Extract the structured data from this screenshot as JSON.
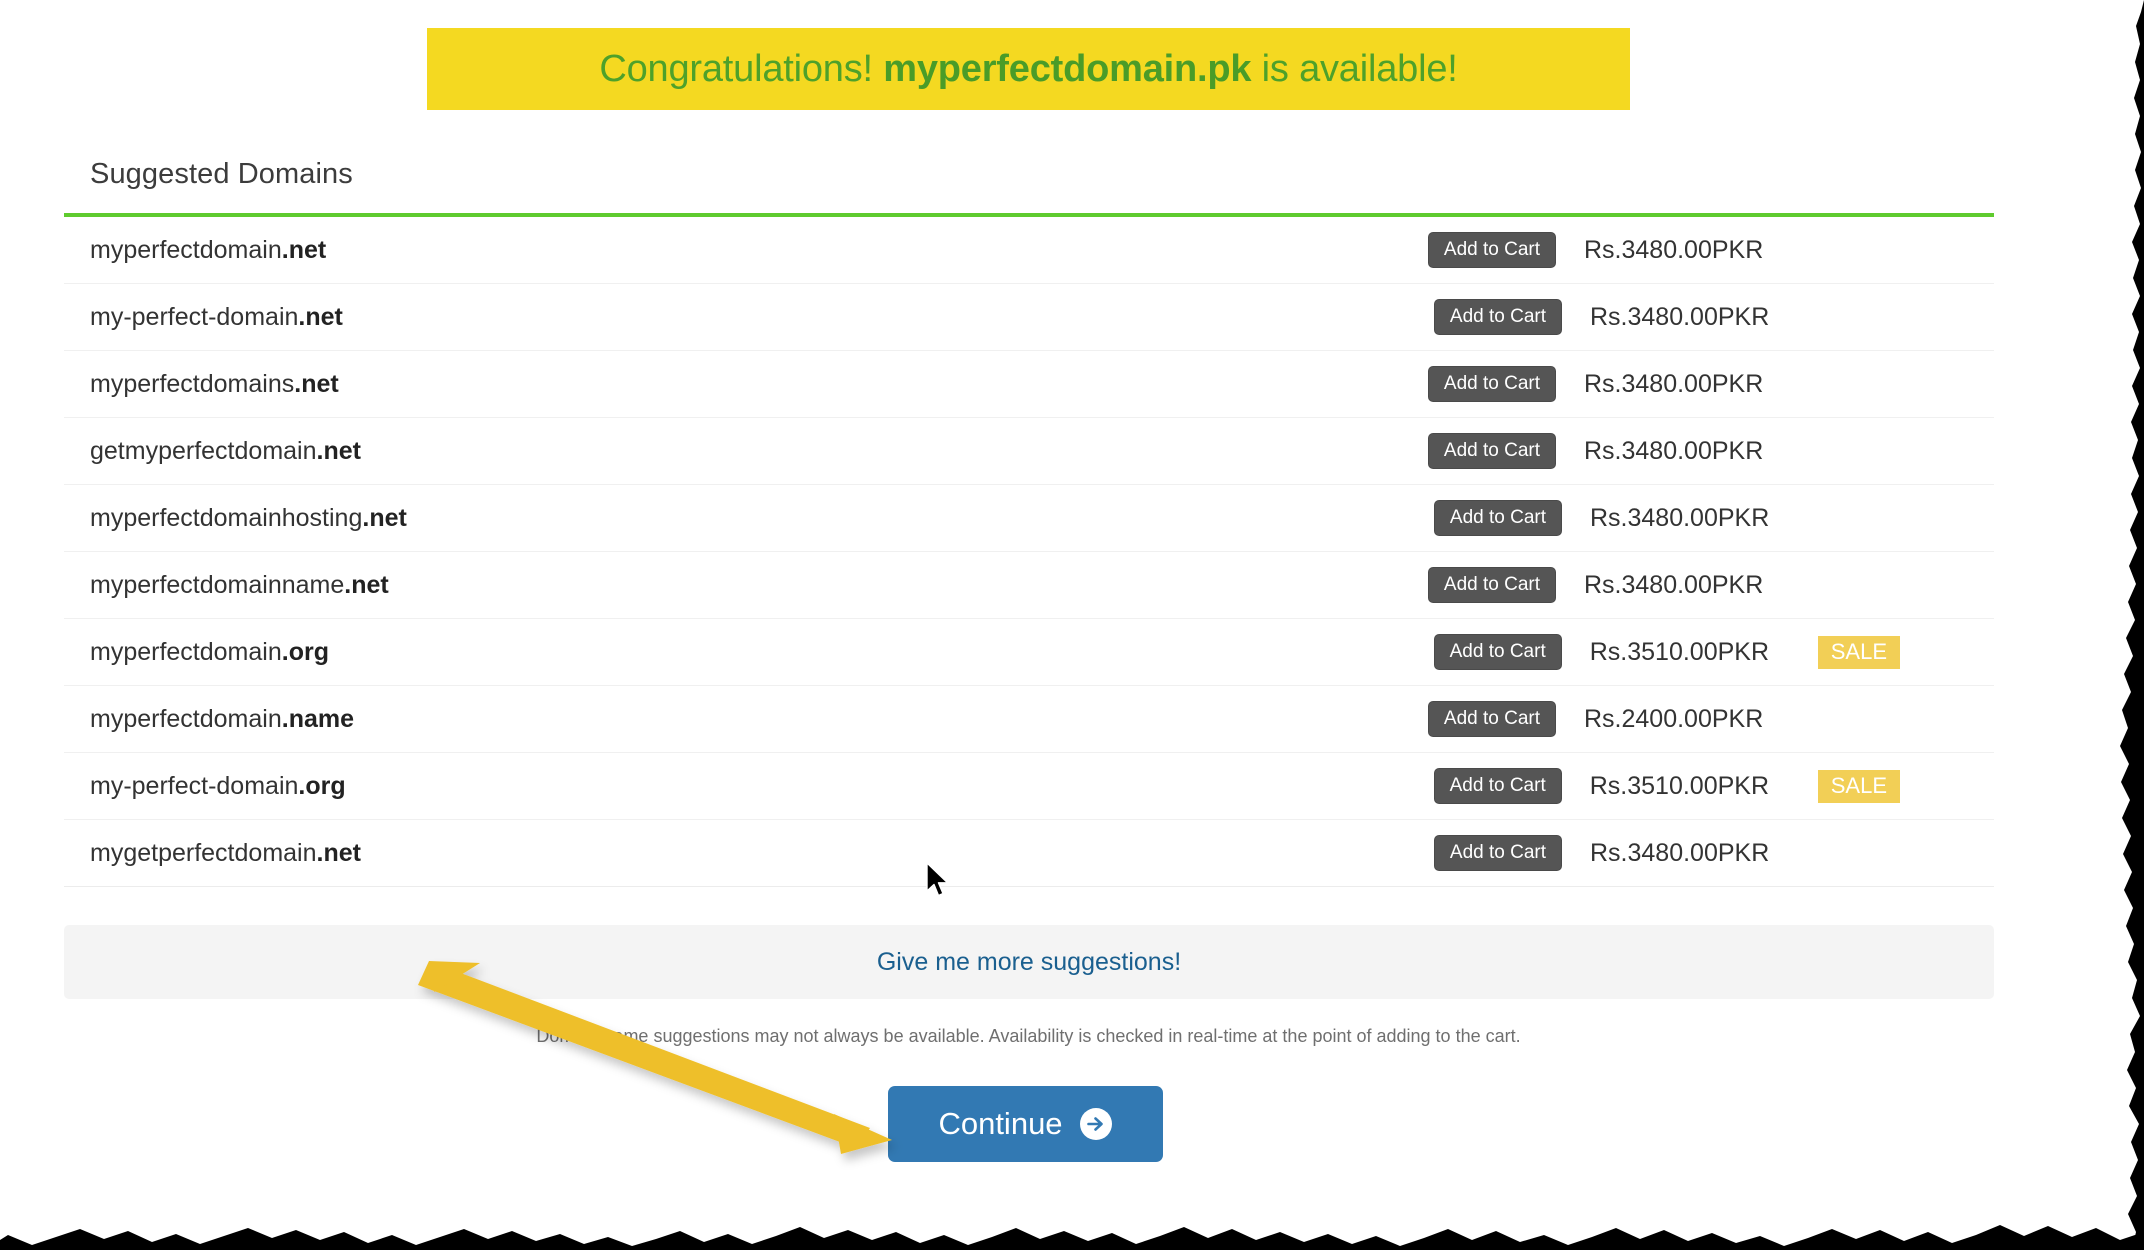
{
  "banner": {
    "prefix": "Congratulations! ",
    "domain": "myperfectdomain.pk",
    "suffix": " is available!",
    "background_color": "#f4d921",
    "text_color": "#4ea12a"
  },
  "section": {
    "heading": "Suggested Domains",
    "divider_color": "#5fcb2e"
  },
  "table": {
    "add_to_cart_label": "Add to Cart",
    "sale_label": "SALE",
    "rows": [
      {
        "name": "myperfectdomain",
        "tld": ".net",
        "price": "Rs.3480.00PKR",
        "sale": false
      },
      {
        "name": "my-perfect-domain",
        "tld": ".net",
        "price": "Rs.3480.00PKR",
        "sale": false
      },
      {
        "name": "myperfectdomains",
        "tld": ".net",
        "price": "Rs.3480.00PKR",
        "sale": false
      },
      {
        "name": "getmyperfectdomain",
        "tld": ".net",
        "price": "Rs.3480.00PKR",
        "sale": false
      },
      {
        "name": "myperfectdomainhosting",
        "tld": ".net",
        "price": "Rs.3480.00PKR",
        "sale": false
      },
      {
        "name": "myperfectdomainname",
        "tld": ".net",
        "price": "Rs.3480.00PKR",
        "sale": false
      },
      {
        "name": "myperfectdomain",
        "tld": ".org",
        "price": "Rs.3510.00PKR",
        "sale": true
      },
      {
        "name": "myperfectdomain",
        "tld": ".name",
        "price": "Rs.2400.00PKR",
        "sale": false
      },
      {
        "name": "my-perfect-domain",
        "tld": ".org",
        "price": "Rs.3510.00PKR",
        "sale": true
      },
      {
        "name": "mygetperfectdomain",
        "tld": ".net",
        "price": "Rs.3480.00PKR",
        "sale": false
      }
    ]
  },
  "more_suggestions": {
    "label": "Give me more suggestions!",
    "link_color": "#1a5f8f",
    "panel_color": "#f4f4f4"
  },
  "disclaimer": {
    "text": "Domain name suggestions may not always be available. Availability is checked in real-time at the point of adding to the cart."
  },
  "continue": {
    "label": "Continue",
    "icon": "arrow-circle-right-icon",
    "background_color": "#3279b3"
  },
  "annotation": {
    "arrow_color": "#eebf2a",
    "points_to": "continue-button"
  },
  "cursor": {
    "type": "default-pointer"
  }
}
